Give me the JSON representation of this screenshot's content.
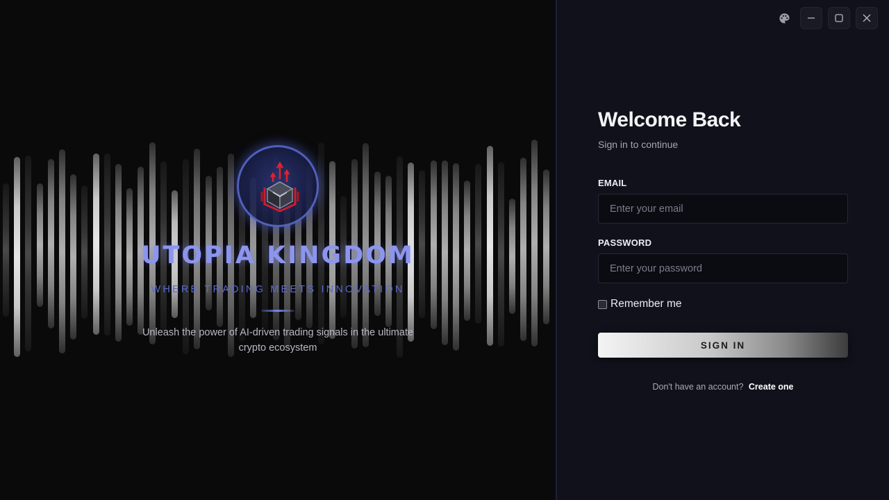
{
  "window": {
    "controls": {
      "palette_icon": "palette-icon",
      "minimize_icon": "minimize-icon",
      "maximize_icon": "maximize-icon",
      "close_icon": "close-icon"
    }
  },
  "hero": {
    "title": "UTOPIA KINGDOM",
    "tagline": "WHERE TRADING MEETS INNOVATION",
    "description": "Unleash the power of AI-driven trading signals in the ultimate crypto ecosystem",
    "logo_icon": "cube-chart-logo-icon",
    "accent_color": "#8c95ee"
  },
  "login": {
    "heading": "Welcome Back",
    "subheading": "Sign in to continue",
    "email": {
      "label": "EMAIL",
      "value": "",
      "placeholder": "Enter your email"
    },
    "password": {
      "label": "PASSWORD",
      "value": "",
      "placeholder": "Enter your password"
    },
    "remember_label": "Remember me",
    "remember_checked": false,
    "signin_label": "SIGN IN",
    "no_account_text": "Don't have an account?",
    "create_link": "Create one"
  }
}
